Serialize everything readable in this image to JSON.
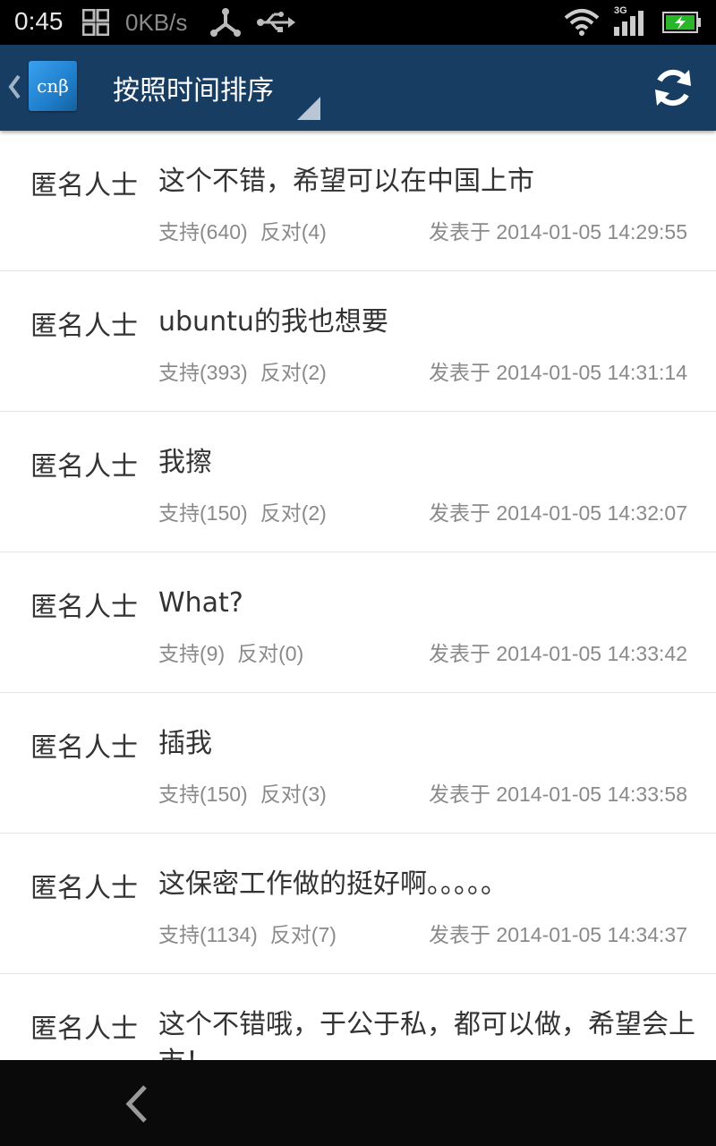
{
  "status_bar": {
    "time": "0:45",
    "net_speed": "0KB/s",
    "network_type": "3G"
  },
  "action_bar": {
    "logo_text": "cnβ",
    "title": "按照时间排序"
  },
  "comments": [
    {
      "author": "匿名人士",
      "content": "这个不错，希望可以在中国上市",
      "support": "支持(640)",
      "oppose": "反对(4)",
      "posted": "发表于 2014-01-05 14:29:55"
    },
    {
      "author": "匿名人士",
      "content": "ubuntu的我也想要",
      "support": "支持(393)",
      "oppose": "反对(2)",
      "posted": "发表于 2014-01-05 14:31:14"
    },
    {
      "author": "匿名人士",
      "content": "我擦",
      "support": "支持(150)",
      "oppose": "反对(2)",
      "posted": "发表于 2014-01-05 14:32:07"
    },
    {
      "author": "匿名人士",
      "content": "What?",
      "support": "支持(9)",
      "oppose": "反对(0)",
      "posted": "发表于 2014-01-05 14:33:42"
    },
    {
      "author": "匿名人士",
      "content": "插我",
      "support": "支持(150)",
      "oppose": "反对(3)",
      "posted": "发表于 2014-01-05 14:33:58"
    },
    {
      "author": "匿名人士",
      "content": "这保密工作做的挺好啊。。。。。",
      "support": "支持(1134)",
      "oppose": "反对(7)",
      "posted": "发表于 2014-01-05 14:34:37"
    },
    {
      "author": "匿名人士",
      "content": "这个不错哦，于公于私，都可以做，希望会上市！"
    }
  ],
  "icons": {
    "grid": "grid-icon",
    "share": "share-icon",
    "usb": "usb-icon",
    "wifi": "wifi-icon",
    "signal": "signal-icon",
    "battery": "battery-charging-icon",
    "back": "chevron-left-icon",
    "dropdown": "dropdown-triangle-icon",
    "refresh": "refresh-icon",
    "nav_back": "back-arrow-icon"
  },
  "colors": {
    "action_bar": "#173d63",
    "status_bar": "#000000",
    "battery": "#2bb52b"
  }
}
